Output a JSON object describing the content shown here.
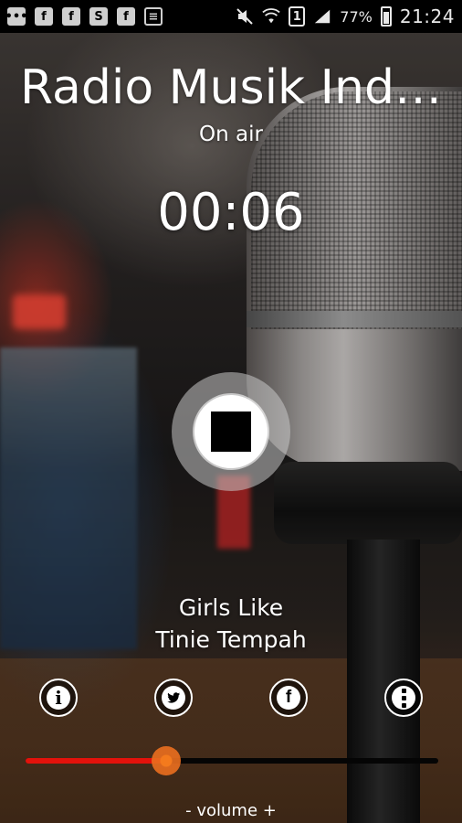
{
  "status_bar": {
    "left_icons": [
      "message-icon",
      "facebook-icon",
      "facebook-icon",
      "skype-icon",
      "facebook-icon",
      "chat-icon"
    ],
    "battery_percent": "77%",
    "sim_label": "1",
    "time": "21:24"
  },
  "player": {
    "station_title": "Radio Musik Ind…",
    "status": "On air",
    "elapsed": "00:06",
    "song_title": "Girls Like",
    "artist": "Tinie Tempah",
    "volume_label": "- volume +",
    "volume_level": 0.34,
    "volume_fill_color": "#e3120b",
    "volume_thumb_color": "#f47a1d"
  },
  "actions": [
    {
      "name": "info",
      "icon": "info-icon"
    },
    {
      "name": "twitter",
      "icon": "twitter-icon"
    },
    {
      "name": "facebook",
      "icon": "facebook-icon"
    },
    {
      "name": "more",
      "icon": "more-options-icon"
    }
  ]
}
